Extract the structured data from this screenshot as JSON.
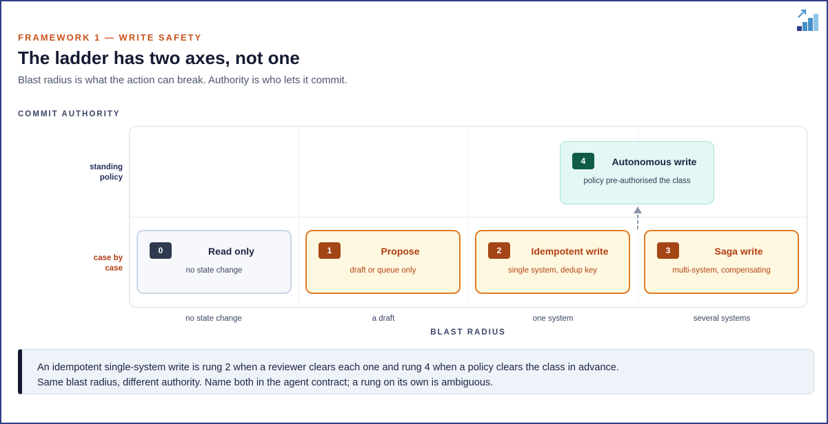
{
  "header": {
    "eyebrow": "FRAMEWORK 1 — WRITE SAFETY",
    "title": "The ladder has two axes, not one",
    "subtitle": "Blast radius is what the action can break. Authority is who lets it commit."
  },
  "logo": {
    "icon": "staircase-chart-arrow-icon",
    "colors": [
      "#2f3f86",
      "#4a90c8",
      "#8ec5e6"
    ]
  },
  "diagram": {
    "y_axis_title": "COMMIT AUTHORITY",
    "x_axis_title": "BLAST RADIUS",
    "rows": [
      {
        "label_line1": "standing",
        "label_line2": "policy"
      },
      {
        "label_line1": "case by",
        "label_line2": "case"
      }
    ],
    "columns": [
      "no state change",
      "a draft",
      "one system",
      "several systems"
    ],
    "rungs": [
      {
        "number": "0",
        "title": "Read only",
        "subtitle": "no state change",
        "row": "case by case",
        "column": "no state change",
        "style": "gray"
      },
      {
        "number": "1",
        "title": "Propose",
        "subtitle": "draft or queue only",
        "row": "case by case",
        "column": "a draft",
        "style": "orange"
      },
      {
        "number": "2",
        "title": "Idempotent write",
        "subtitle": "single system, dedup key",
        "row": "case by case",
        "column": "one system",
        "style": "orange"
      },
      {
        "number": "3",
        "title": "Saga write",
        "subtitle": "multi-system, compensating",
        "row": "case by case",
        "column": "several systems",
        "style": "orange"
      },
      {
        "number": "4",
        "title": "Autonomous write",
        "subtitle": "policy pre-authorised the class",
        "row": "standing policy",
        "column": "one system",
        "style": "teal"
      }
    ],
    "arrow": {
      "from_rung": "2",
      "to_rung": "4",
      "style": "dashed"
    },
    "colors": {
      "orange_border": "#e07b24",
      "orange_fill": "#fff8e1",
      "teal_border": "#a3e3d9",
      "teal_fill": "#e3f7f4",
      "accent": "#c9531d"
    }
  },
  "callout": {
    "line1": "An idempotent single-system write is rung 2 when a reviewer clears each one and rung 4 when a policy clears the class in advance.",
    "line2": "Same blast radius, different authority. Name both in the agent contract; a rung on its own is ambiguous."
  }
}
